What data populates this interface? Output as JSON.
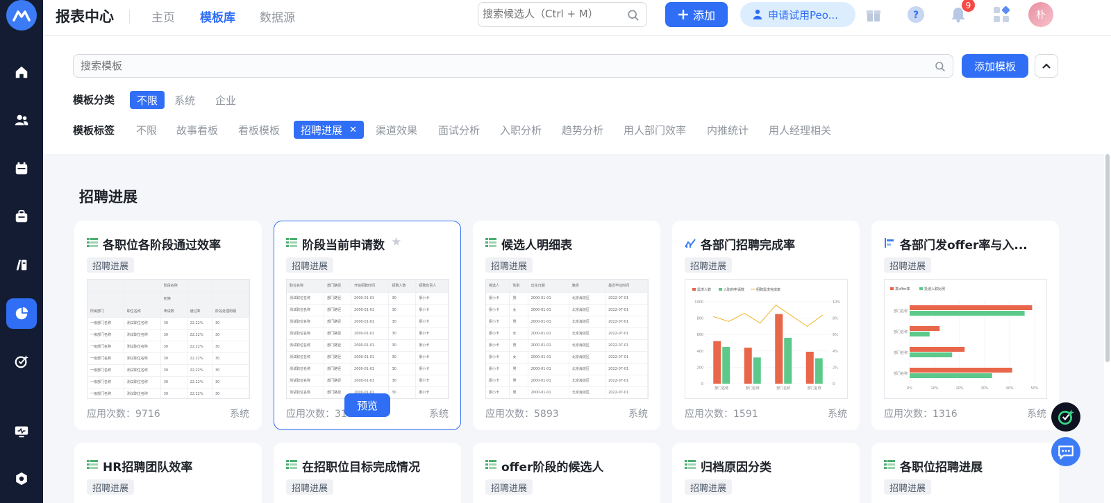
{
  "app": {
    "title": "报表中心"
  },
  "nav": [
    {
      "label": "主页",
      "active": false
    },
    {
      "label": "模板库",
      "active": true
    },
    {
      "label": "数据源",
      "active": false
    }
  ],
  "top_search": {
    "placeholder": "搜索候选人（Ctrl + M）"
  },
  "add_button": "添加",
  "trial_button": "申请试用Peo...",
  "notifications": {
    "count": "9"
  },
  "avatar_text": "朴",
  "template_search": {
    "placeholder": "搜索模板"
  },
  "add_template_button": "添加模板",
  "category": {
    "label": "模板分类",
    "options": [
      "不限",
      "系统",
      "企业"
    ],
    "selected": "不限"
  },
  "tags": {
    "label": "模板标签",
    "options": [
      "不限",
      "故事看板",
      "看板模板",
      "招聘进展",
      "渠道效果",
      "面试分析",
      "入职分析",
      "趋势分析",
      "用人部门效率",
      "内推统计",
      "用人经理相关"
    ],
    "selected": "招聘进展"
  },
  "section_title": "招聘进展",
  "usage_prefix": "应用次数：",
  "cards": [
    {
      "title": "各职位各阶段通过效率",
      "tag": "招聘进展",
      "usage": "应用次数：9716",
      "source": "系统",
      "icon": "table-icon"
    },
    {
      "title": "阶段当前申请数",
      "tag": "招聘进展",
      "usage": "应用次数：3165",
      "source": "系统",
      "icon": "table-icon",
      "preview": "预览"
    },
    {
      "title": "候选人明细表",
      "tag": "招聘进展",
      "usage": "应用次数：5893",
      "source": "系统",
      "icon": "table-icon"
    },
    {
      "title": "各部门招聘完成率",
      "tag": "招聘进展",
      "usage": "应用次数：1591",
      "source": "系统",
      "icon": "line-chart-icon"
    },
    {
      "title": "各部门发offer率与入...",
      "tag": "招聘进展",
      "usage": "应用次数：1316",
      "source": "系统",
      "icon": "bar-chart-icon"
    }
  ],
  "cards_row2": [
    {
      "title": "HR招聘团队效率",
      "tag": "招聘进展"
    },
    {
      "title": "在招职位目标完成情况",
      "tag": "招聘进展"
    },
    {
      "title": "offer阶段的候选人",
      "tag": "招聘进展"
    },
    {
      "title": "归档原因分类",
      "tag": "招聘进展"
    },
    {
      "title": "各职位招聘进展",
      "tag": "招聘进展"
    }
  ],
  "thumb1": {
    "header_top": "阶段名称",
    "header_sub": "初筛",
    "cols": [
      "所属部门",
      "职位名称",
      "申请数",
      "通过率",
      "阶段处理周期"
    ],
    "rows": [
      [
        "一级部门名称",
        "测试职位名称",
        "30",
        "22.22%",
        "30"
      ],
      [
        "一级部门名称",
        "测试职位名称",
        "30",
        "22.22%",
        "30"
      ],
      [
        "一级部门名称",
        "测试职位名称",
        "30",
        "22.22%",
        "30"
      ],
      [
        "一级部门名称",
        "测试职位名称",
        "30",
        "22.22%",
        "30"
      ],
      [
        "一级部门名称",
        "测试职位名称",
        "30",
        "22.22%",
        "30"
      ],
      [
        "一级部门名称",
        "测试职位名称",
        "30",
        "22.22%",
        "30"
      ],
      [
        "一级部门名称",
        "测试职位名称",
        "30",
        "22.22%",
        "30"
      ],
      [
        "一级部门名称",
        "测试职位名称",
        "30",
        "22.22%",
        "30"
      ]
    ]
  },
  "thumb2": {
    "cols": [
      "职位名称",
      "部门路径",
      "开始招聘时间",
      "招聘人数",
      "招聘负责人"
    ],
    "rows": [
      [
        "测试职位名称",
        "部门路径",
        "2000-01-01",
        "30",
        "廖小卡"
      ],
      [
        "测试职位名称",
        "部门路径",
        "2000-01-01",
        "30",
        "廖小卡"
      ],
      [
        "测试职位名称",
        "部门路径",
        "2000-01-01",
        "30",
        "廖小卡"
      ],
      [
        "测试职位名称",
        "部门路径",
        "2000-01-01",
        "30",
        "廖小卡"
      ],
      [
        "测试职位名称",
        "部门路径",
        "2000-01-01",
        "30",
        "廖小卡"
      ],
      [
        "测试职位名称",
        "部门路径",
        "2000-01-01",
        "30",
        "廖小卡"
      ],
      [
        "测试职位名称",
        "部门路径",
        "2000-01-01",
        "30",
        "廖小卡"
      ],
      [
        "测试职位名称",
        "部门路径",
        "2000-01-01",
        "30",
        "廖小卡"
      ],
      [
        "测试职位名称",
        "部门路径",
        "2000-01-01",
        "30",
        "廖小卡"
      ]
    ]
  },
  "thumb3": {
    "cols": [
      "候选人",
      "性别",
      "出生日期",
      "籍贯",
      "最近毕业时间"
    ],
    "rows": [
      [
        "廖小卡",
        "男",
        "2000-01-01",
        "北京海淀区",
        "2022-07-01"
      ],
      [
        "廖小卡",
        "女",
        "2000-01-01",
        "北京海淀区",
        "2022-07-01"
      ],
      [
        "廖小卡",
        "男",
        "2000-01-01",
        "北京海淀区",
        "2022-07-01"
      ],
      [
        "廖小卡",
        "女",
        "2000-01-01",
        "北京海淀区",
        "2022-07-01"
      ],
      [
        "廖小卡",
        "男",
        "2000-01-01",
        "北京海淀区",
        "2022-07-01"
      ],
      [
        "廖小卡",
        "女",
        "2000-01-01",
        "北京海淀区",
        "2022-07-01"
      ],
      [
        "廖小卡",
        "男",
        "2000-01-01",
        "北京海淀区",
        "2022-07-01"
      ],
      [
        "廖小卡",
        "男",
        "2000-01-01",
        "北京海淀区",
        "2022-07-01"
      ],
      [
        "廖小卡",
        "男",
        "2000-01-01",
        "北京海淀区",
        "2022-07-01"
      ]
    ]
  },
  "chart_data": [
    {
      "type": "bar",
      "legend": [
        "需求人数",
        "入职的申请数",
        "招聘需求完成率"
      ],
      "categories": [
        "部门名称",
        "部门名称",
        "部门名称",
        "部门名称"
      ],
      "series": [
        {
          "name": "需求人数",
          "values": [
            520,
            440,
            850,
            390
          ],
          "color": "#e8664a"
        },
        {
          "name": "入职的申请数",
          "values": [
            450,
            320,
            560,
            310
          ],
          "color": "#5cc98a"
        }
      ],
      "line": {
        "name": "招聘需求完成率",
        "values": [
          8.2,
          7.6,
          8.6,
          7.4,
          9.6,
          8.3,
          7.0,
          8.4
        ],
        "color": "#f0b429"
      },
      "ylim": [
        0,
        1000
      ],
      "yticks": [
        "0",
        "200",
        "400",
        "600",
        "800",
        "1000"
      ],
      "y2ticks": [
        "0",
        "2%",
        "4%",
        "6%",
        "8%",
        "10%"
      ]
    },
    {
      "type": "bar",
      "orientation": "horizontal",
      "legend": [
        "发offer率",
        "投递入职比例"
      ],
      "categories": [
        "部门名称",
        "部门名称",
        "部门名称",
        "部门名称"
      ],
      "series": [
        {
          "name": "发offer率",
          "values": [
            49,
            12,
            22,
            41
          ],
          "color": "#e8664a"
        },
        {
          "name": "投递入职比例",
          "values": [
            46,
            8,
            17,
            33
          ],
          "color": "#5cc98a"
        }
      ],
      "xlim": [
        0,
        50
      ],
      "xticks": [
        "0%",
        "10%",
        "20%",
        "30%",
        "40%",
        "50%"
      ]
    }
  ]
}
